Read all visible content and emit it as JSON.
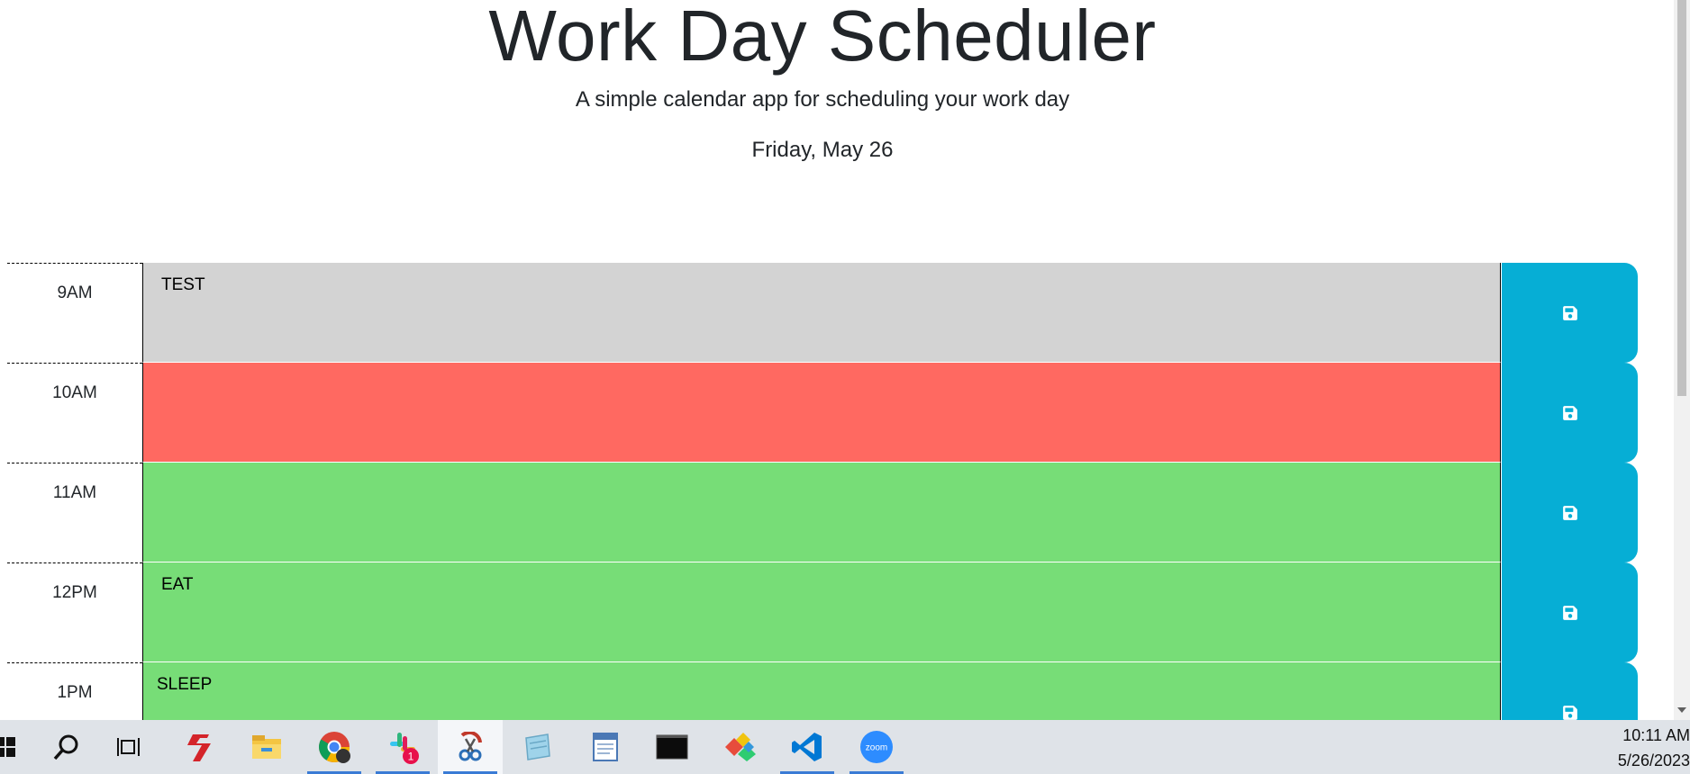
{
  "header": {
    "title": "Work Day Scheduler",
    "lead": "A simple calendar app for scheduling your work day",
    "current_day": "Friday, May 26"
  },
  "rows": [
    {
      "hour": "9AM",
      "text": "TEST",
      "status": "past"
    },
    {
      "hour": "10AM",
      "text": "",
      "status": "present"
    },
    {
      "hour": "11AM",
      "text": "",
      "status": "future"
    },
    {
      "hour": "12PM",
      "text": "EAT",
      "status": "future"
    },
    {
      "hour": "1PM",
      "text": "SLEEP",
      "status": "future"
    }
  ],
  "icons": {
    "save": "floppy-disk-icon"
  },
  "colors": {
    "past": "#d3d3d3",
    "present": "#ff6961",
    "future": "#77dd77",
    "save_button": "#06aed5"
  },
  "taskbar": {
    "items": [
      "windows-start-icon",
      "search-icon",
      "task-view-icon",
      "app-s-icon",
      "file-explorer-icon",
      "chrome-icon",
      "slack-icon",
      "snipping-tool-icon",
      "notepad-icon",
      "wordpad-icon",
      "terminal-icon",
      "app-puzzle-icon",
      "vscode-icon",
      "zoom-icon"
    ],
    "slack_badge": "1",
    "zoom_label": "zoom",
    "time": "10:11 AM",
    "date": "5/26/2023"
  }
}
